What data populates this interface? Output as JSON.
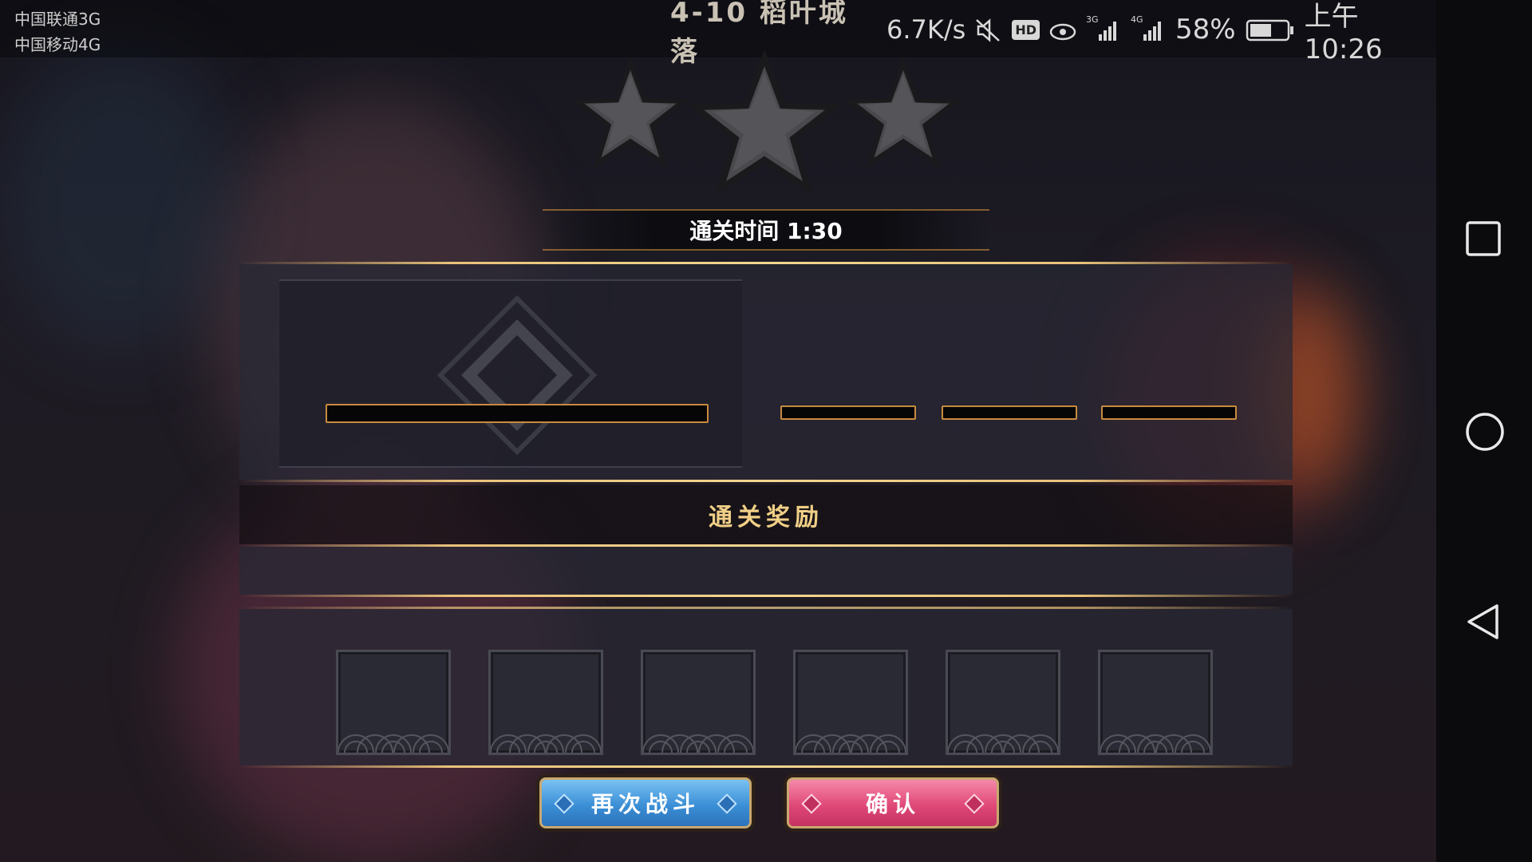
{
  "status_bar": {
    "carrier_1": "中国联通3G",
    "carrier_2": "中国移动4G",
    "stage_label": "4-10 稻叶城落",
    "speed": "6.7K/s",
    "hd_badge": "HD",
    "net_3g": "3G",
    "net_4g": "4G",
    "battery": "58%",
    "battery_level": 0.58,
    "time": "上午10:26"
  },
  "result": {
    "stars_earned": 0,
    "stars_total": 3,
    "clear_time": "通关时间 1:30",
    "reward_title": "通关奖励",
    "reward_slot_count": 6
  },
  "buttons": {
    "retry_label": "再次战斗",
    "confirm_label": "确认"
  },
  "colors": {
    "accent_gold": "#e8c27a",
    "bar_border": "#c98a3e",
    "retry_blue": "#3b8fd6",
    "confirm_pink": "#e04878"
  },
  "nav": {
    "icons": [
      "recent-apps-icon",
      "home-icon",
      "back-icon"
    ]
  }
}
